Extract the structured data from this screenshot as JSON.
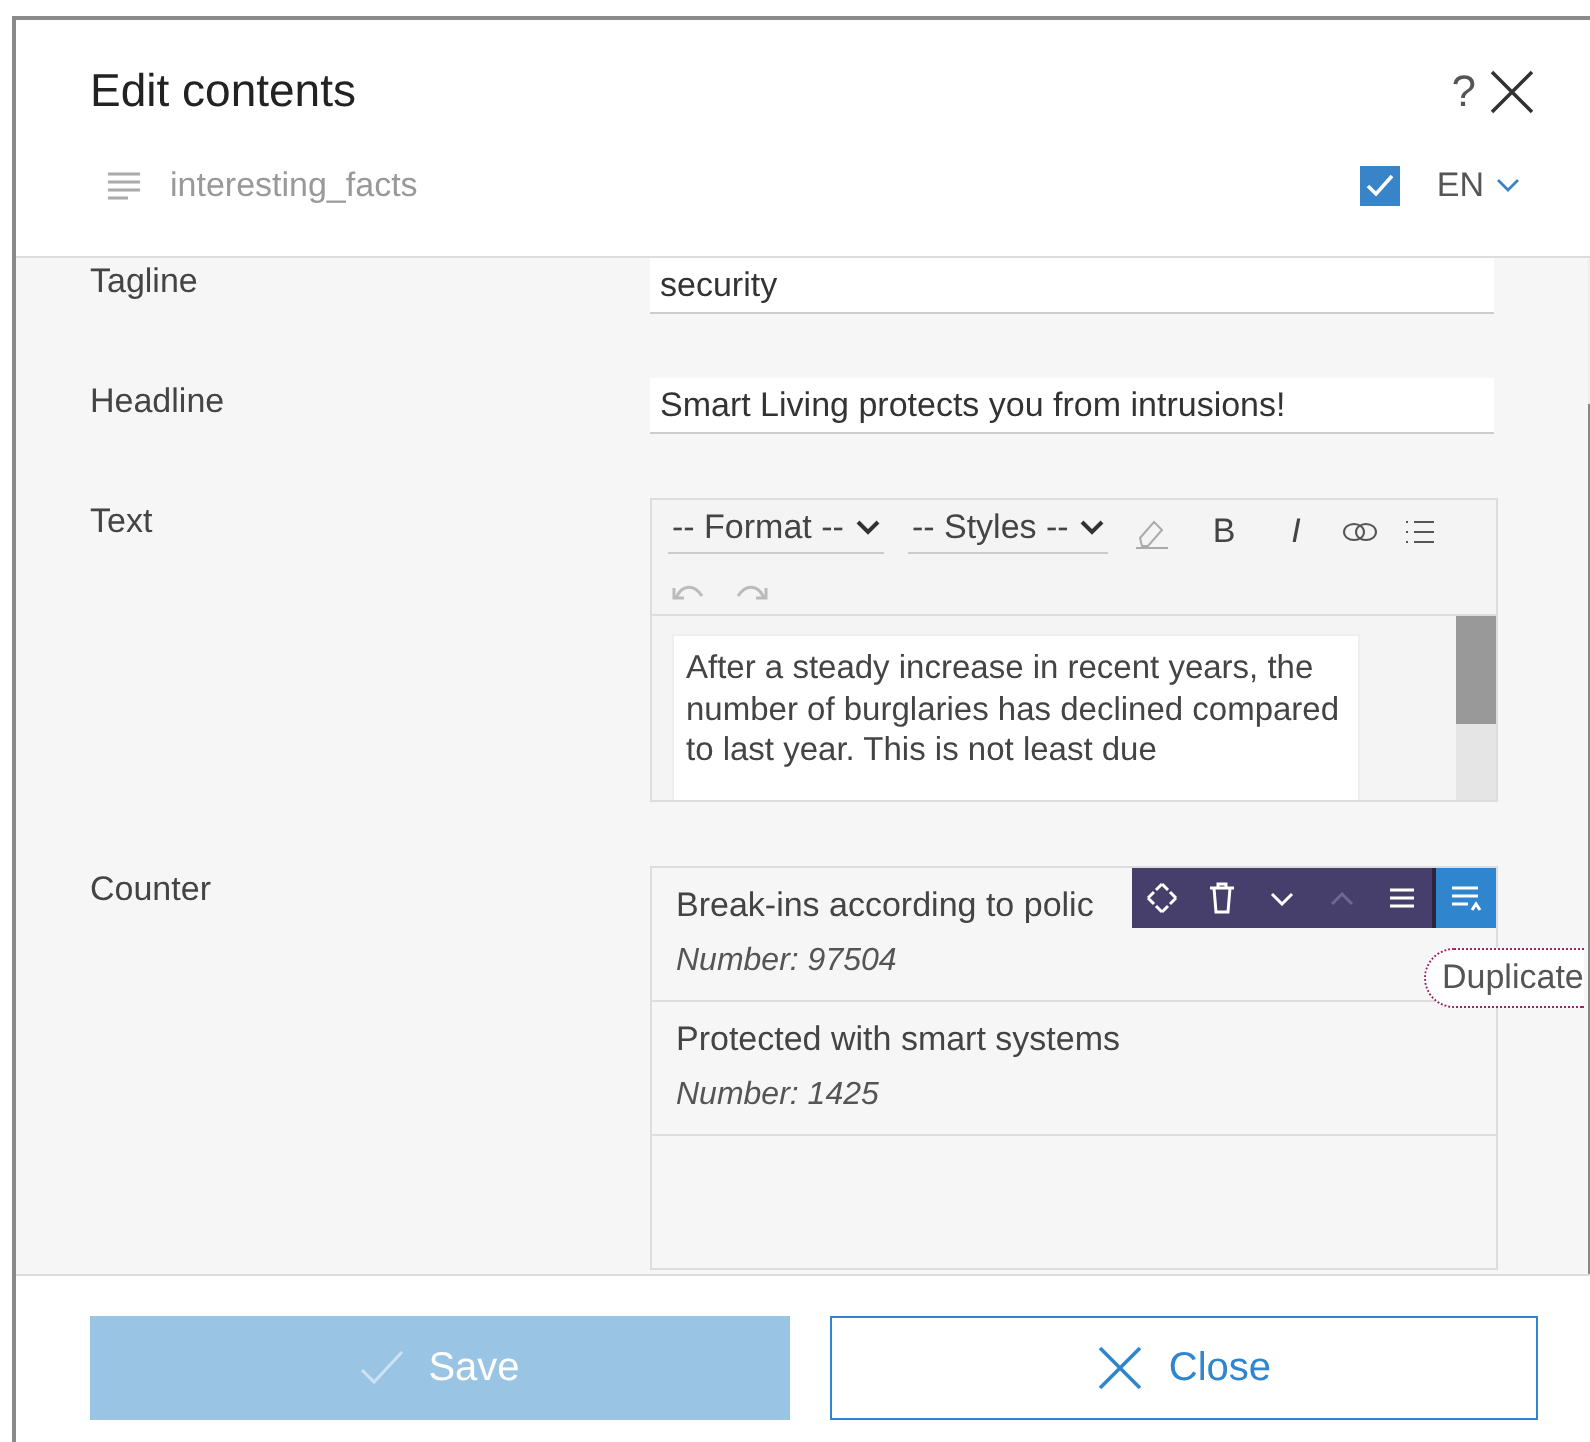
{
  "dialog": {
    "title": "Edit contents",
    "help": "?"
  },
  "subheader": {
    "name": "interesting_facts",
    "language_checked": true,
    "language": "EN"
  },
  "fields": [
    {
      "kind": "text",
      "label": "Tagline",
      "value": "security"
    },
    {
      "kind": "text",
      "label": "Headline",
      "value": "Smart Living protects you from intrusions!"
    },
    {
      "kind": "richtext",
      "label": "Text",
      "format": "-- Format --",
      "styles": "-- Styles --",
      "bold": "B",
      "italic": "I",
      "content": "After a steady increase in recent years, the number of burglaries has declined compared to last year. This is not least due"
    },
    {
      "kind": "list",
      "label": "Counter",
      "items": [
        {
          "title": "Break-ins according to polic",
          "number": "Number: 97504",
          "tools": [
            {
              "kind": "move",
              "disabled": false,
              "selected": false
            },
            {
              "kind": "delete",
              "disabled": false,
              "selected": false
            },
            {
              "kind": "down",
              "disabled": false,
              "selected": false
            },
            {
              "kind": "up",
              "disabled": true,
              "selected": false
            },
            {
              "kind": "duplicate",
              "disabled": false,
              "selected": false
            },
            {
              "kind": "insert",
              "disabled": false,
              "selected": true
            }
          ],
          "tooltip": "Duplicate"
        },
        {
          "title": "Protected with smart systems",
          "number": "Number: 1425"
        }
      ]
    }
  ],
  "buttons": [
    {
      "kind": "save",
      "label": "Save",
      "disabled": true
    },
    {
      "kind": "close",
      "label": "Close"
    }
  ]
}
